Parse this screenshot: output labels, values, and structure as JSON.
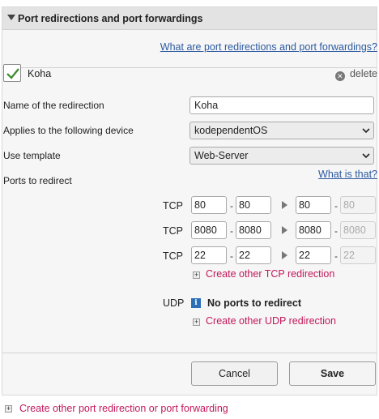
{
  "header": {
    "title": "Port redirections and port forwardings"
  },
  "help_link": "What are port redirections and port forwardings?",
  "entry": {
    "checked": true,
    "name": "Koha",
    "delete_label": "delete"
  },
  "form": {
    "name_label": "Name of the redirection",
    "name_value": "Koha",
    "device_label": "Applies to the following device",
    "device_value": "kodependentOS",
    "template_label": "Use template",
    "template_value": "Web-Server",
    "ports_label": "Ports to redirect",
    "what_is_that": "What is that?"
  },
  "tcp": {
    "label": "TCP",
    "rows": [
      {
        "from_start": "80",
        "from_end": "80",
        "to_start": "80",
        "to_end": "80"
      },
      {
        "from_start": "8080",
        "from_end": "8080",
        "to_start": "8080",
        "to_end": "8080"
      },
      {
        "from_start": "22",
        "from_end": "22",
        "to_start": "22",
        "to_end": "22"
      }
    ],
    "add_link": "Create other TCP redirection"
  },
  "udp": {
    "label": "UDP",
    "empty_text": "No ports to redirect",
    "add_link": "Create other UDP redirection"
  },
  "buttons": {
    "cancel": "Cancel",
    "save": "Save"
  },
  "footer": {
    "add_link": "Create other port redirection or port forwarding"
  },
  "colors": {
    "link_blue": "#2c5aa0",
    "link_pink": "#c2185b",
    "check_green": "#3a8a2a"
  }
}
